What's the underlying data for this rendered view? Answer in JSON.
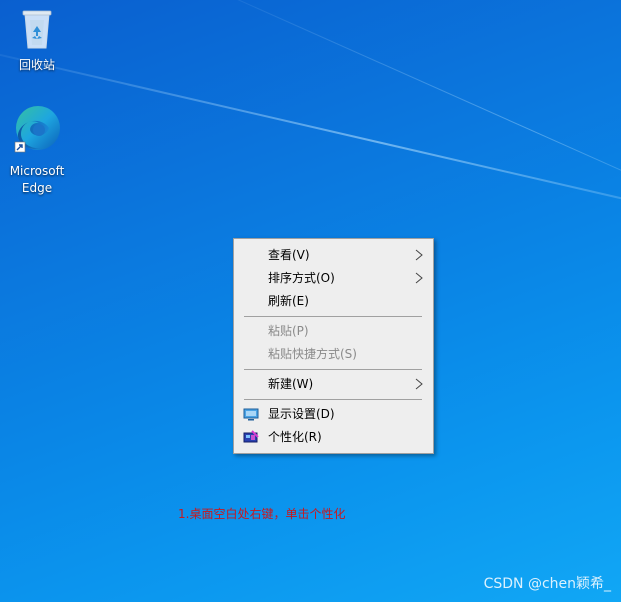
{
  "desktop": {
    "icons": [
      {
        "label": "回收站",
        "icon": "recycle-bin-icon"
      },
      {
        "label": "Microsoft\nEdge",
        "icon": "edge-icon"
      }
    ]
  },
  "context_menu": {
    "view": {
      "label": "查看(V)",
      "has_submenu": true
    },
    "sort": {
      "label": "排序方式(O)",
      "has_submenu": true
    },
    "refresh": {
      "label": "刷新(E)"
    },
    "paste": {
      "label": "粘贴(P)",
      "disabled": true
    },
    "paste_shortcut": {
      "label": "粘贴快捷方式(S)",
      "disabled": true
    },
    "new": {
      "label": "新建(W)",
      "has_submenu": true
    },
    "display_settings": {
      "label": "显示设置(D)",
      "icon": "display-icon"
    },
    "personalize": {
      "label": "个性化(R)",
      "icon": "personalize-icon"
    }
  },
  "annotation": {
    "text": "1.桌面空白处右键，单击个性化",
    "color": "#c8181f"
  },
  "watermark": {
    "text": "CSDN @chen颖希_"
  }
}
